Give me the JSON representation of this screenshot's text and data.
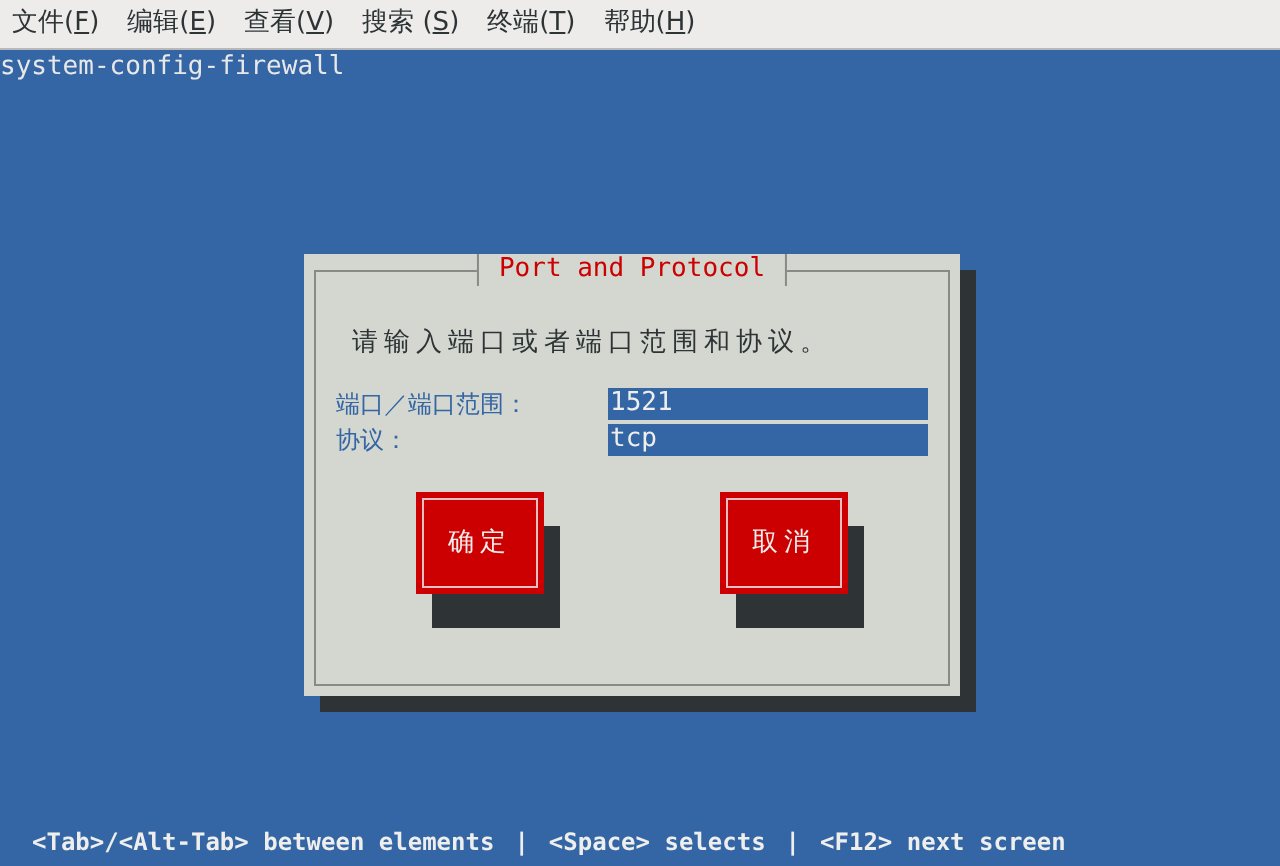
{
  "menu": [
    {
      "before": "文件(",
      "key": "F",
      "after": ")"
    },
    {
      "before": "编辑(",
      "key": "E",
      "after": ")"
    },
    {
      "before": "查看(",
      "key": "V",
      "after": ")"
    },
    {
      "before": "搜索 (",
      "key": "S",
      "after": ")"
    },
    {
      "before": "终端(",
      "key": "T",
      "after": ")"
    },
    {
      "before": "帮助(",
      "key": "H",
      "after": ")"
    }
  ],
  "terminal_title": "system-config-firewall",
  "dialog": {
    "title": "Port and Protocol",
    "prompt": "请输入端口或者端口范围和协议。",
    "fields": [
      {
        "label": "端口／端口范围：",
        "value": "1521"
      },
      {
        "label": "协议：",
        "value": "tcp"
      }
    ],
    "buttons": [
      "确定",
      "取消"
    ]
  },
  "status_bar": [
    "<Tab>/<Alt-Tab> between elements",
    "|",
    "<Space> selects",
    "|",
    "<F12> next screen"
  ]
}
